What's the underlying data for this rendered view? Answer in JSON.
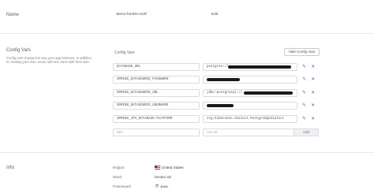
{
  "name_section": {
    "title": "Name",
    "app_name": "-demo-b440n-rootf",
    "edit_label": "Edit"
  },
  "config_section": {
    "title": "Config Vars",
    "description": "Config vars change the way your app behaves. In addition to creating your own, some add-ons come with their own.",
    "subtitle": "Config Vars",
    "hide_button": "Hide Config Vars",
    "rows": [
      {
        "key": "DATABASE_URL",
        "value": "postgres://"
      },
      {
        "key": "SPRING_DATASOURCE_PASSWORD",
        "value": ""
      },
      {
        "key": "SPRING_DATASOURCE_URL",
        "value": "jdbc:postgresql://"
      },
      {
        "key": "SPRING_DATASOURCE_USERNAME",
        "value": ""
      },
      {
        "key": "SPRING_JPA_DATABASE-PLATFORM",
        "value": "org.hibernate.dialect.PostgreSQLDialect"
      }
    ],
    "new_key_placeholder": "KEY",
    "new_value_placeholder": "VALUE",
    "add_button": "Add",
    "edit_icon": "pencil-icon",
    "delete_icon": "close-icon"
  },
  "info_section": {
    "title": "Info",
    "region_label": "Region",
    "region_value": "United States",
    "stack_label": "Stack",
    "stack_value": "heroku-18",
    "framework_label": "Framework",
    "framework_value": "Java"
  },
  "colors": {
    "divider": "#e7e9ed",
    "edit_icon": "#7c6aa6",
    "delete_icon": "#5b6dbd",
    "redaction": "#1a1a1a"
  }
}
